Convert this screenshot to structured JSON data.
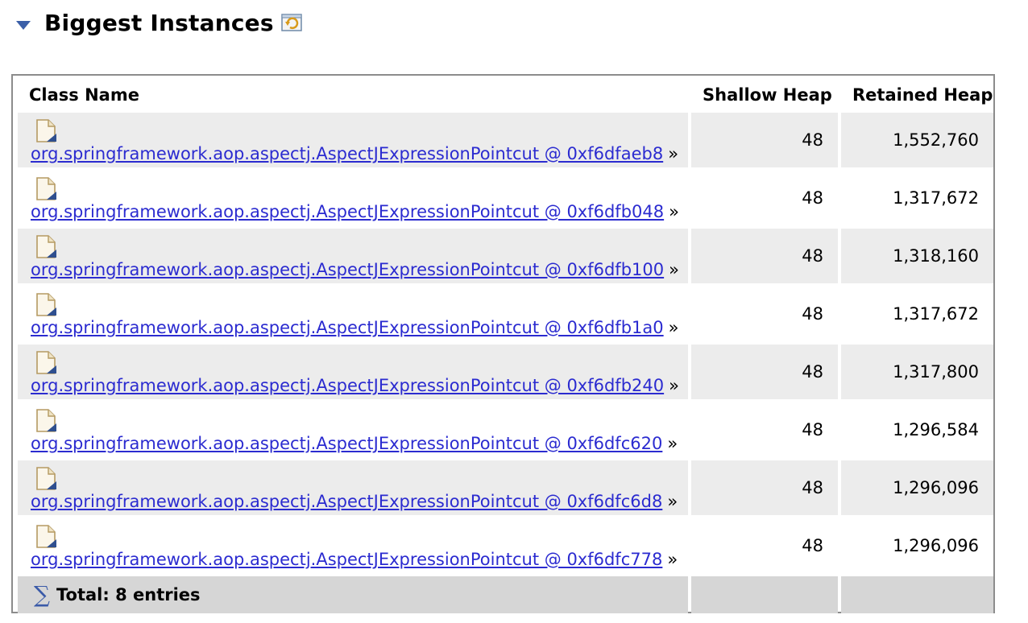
{
  "section": {
    "title": "Biggest Instances",
    "toggle_icon": "triangle-down-icon",
    "action_icon": "refresh-icon"
  },
  "table": {
    "columns": [
      "Class Name",
      "Shallow Heap",
      "Retained Heap"
    ],
    "rows": [
      {
        "name": "org.springframework.aop.aspectj.AspectJExpressionPointcut @ 0xf6dfaeb8",
        "shallow": "48",
        "retained": "1,552,760"
      },
      {
        "name": "org.springframework.aop.aspectj.AspectJExpressionPointcut @ 0xf6dfb048",
        "shallow": "48",
        "retained": "1,317,672"
      },
      {
        "name": "org.springframework.aop.aspectj.AspectJExpressionPointcut @ 0xf6dfb100",
        "shallow": "48",
        "retained": "1,318,160"
      },
      {
        "name": "org.springframework.aop.aspectj.AspectJExpressionPointcut @ 0xf6dfb1a0",
        "shallow": "48",
        "retained": "1,317,672"
      },
      {
        "name": "org.springframework.aop.aspectj.AspectJExpressionPointcut @ 0xf6dfb240",
        "shallow": "48",
        "retained": "1,317,800"
      },
      {
        "name": "org.springframework.aop.aspectj.AspectJExpressionPointcut @ 0xf6dfc620",
        "shallow": "48",
        "retained": "1,296,584"
      },
      {
        "name": "org.springframework.aop.aspectj.AspectJExpressionPointcut @ 0xf6dfc6d8",
        "shallow": "48",
        "retained": "1,296,096"
      },
      {
        "name": "org.springframework.aop.aspectj.AspectJExpressionPointcut @ 0xf6dfc778",
        "shallow": "48",
        "retained": "1,296,096"
      }
    ],
    "more_glyph": "»",
    "row_icon": "document-object-icon",
    "total_label": "Total: 8 entries",
    "total_icon": "sigma-icon"
  },
  "colors": {
    "link": "#2b2bd0",
    "shaded_row": "#ececec",
    "total_row": "#d6d6d6",
    "toggle": "#3b5fa8"
  }
}
